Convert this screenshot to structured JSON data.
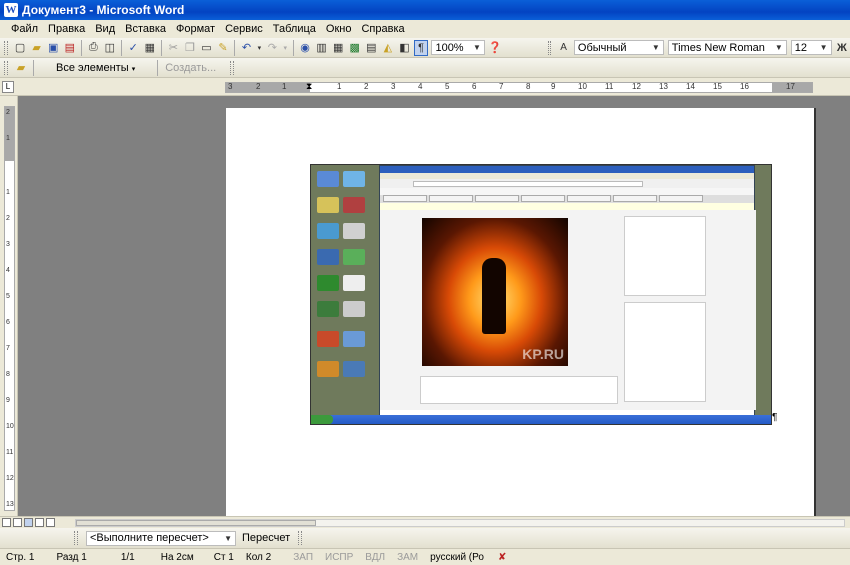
{
  "window": {
    "title": "Документ3 - Microsoft Word"
  },
  "menu": [
    "Файл",
    "Правка",
    "Вид",
    "Вставка",
    "Формат",
    "Сервис",
    "Таблица",
    "Окно",
    "Справка"
  ],
  "toolbar": {
    "zoom": "100%",
    "style": "Обычный",
    "font": "Times New Roman",
    "size": "12"
  },
  "toolbar2": {
    "elements_label": "Все элементы",
    "create_label": "Создать..."
  },
  "ruler": {
    "h_numbers": [
      "3",
      "2",
      "1",
      "1",
      "2",
      "3",
      "4",
      "5",
      "6",
      "7",
      "8",
      "9",
      "10",
      "11",
      "12",
      "13",
      "14",
      "15",
      "16",
      "17"
    ],
    "v_numbers": [
      "2",
      "1",
      "1",
      "2",
      "3",
      "4",
      "5",
      "6",
      "7",
      "8",
      "9",
      "10",
      "11",
      "12",
      "13"
    ]
  },
  "fieldbar": {
    "field_value": "<Выполните пересчет>",
    "recalc_label": "Пересчет"
  },
  "status": {
    "page": "Стр. 1",
    "section": "Разд 1",
    "pages": "1/1",
    "at": "На 2см",
    "line": "Ст 1",
    "col": "Кол 2",
    "rec": "ЗАП",
    "trk": "ИСПР",
    "ext": "ВДЛ",
    "ovr": "ЗАМ",
    "lang": "русский (Ро"
  },
  "embedded": {
    "watermark": "KP.RU"
  }
}
